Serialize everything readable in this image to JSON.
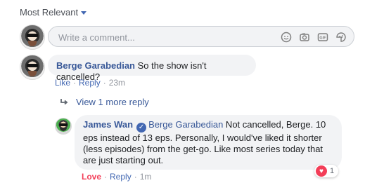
{
  "sort": {
    "label": "Most Relevant"
  },
  "composer": {
    "placeholder": "Write a comment...",
    "icons": [
      "emoji-icon",
      "camera-icon",
      "gif-icon",
      "sticker-icon"
    ]
  },
  "comments": [
    {
      "author": "Berge Garabedian",
      "text": "So the show isn't cancelled?",
      "actions": {
        "like": "Like",
        "reply": "Reply",
        "time": "23m"
      }
    }
  ],
  "view_more": {
    "label": "View 1 more reply"
  },
  "reply": {
    "author": "James Wan",
    "verified": true,
    "mention": "Berge Garabedian",
    "text": " Not cancelled, Berge. 10 eps instead of 13 eps. Personally, I would've liked it shorter (less episodes) from the get-go. Like most series today that are just starting out.",
    "actions": {
      "love": "Love",
      "reply": "Reply",
      "time": "1m"
    },
    "reaction": {
      "type": "love",
      "count": "1"
    }
  },
  "colors": {
    "link": "#385898",
    "accent": "#4267b2",
    "love": "#f33e58",
    "bubble": "#f2f3f5"
  }
}
